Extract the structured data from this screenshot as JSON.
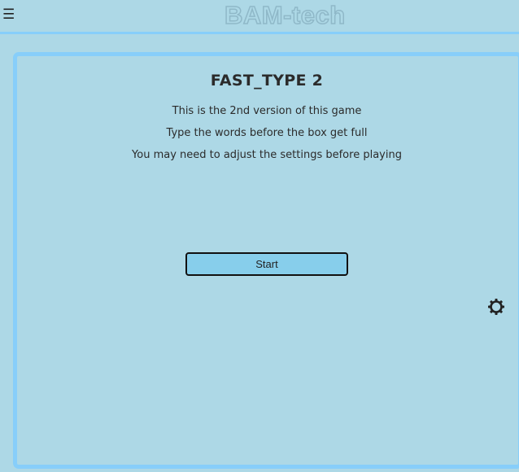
{
  "header": {
    "menu_glyph": "☰",
    "logo_text": "BAM-tech"
  },
  "game": {
    "title": "FAST_TYPE 2",
    "lines": [
      "This is the 2nd version of this game",
      "Type the words before the box get full",
      "You may need to adjust the settings before playing"
    ],
    "start_label": "Start"
  },
  "icons": {
    "menu": "hamburger-menu-icon",
    "settings": "gear-icon"
  },
  "colors": {
    "background": "#add8e6",
    "border_accent": "#87cefa",
    "button_fill": "#87ceeb"
  }
}
